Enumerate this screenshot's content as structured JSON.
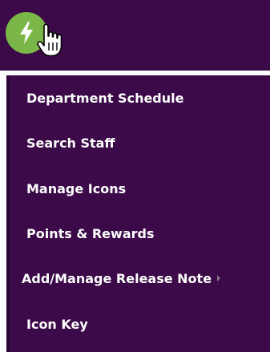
{
  "topbar": {
    "icon": "lightning-bolt-icon",
    "accent_color": "#7ab648",
    "background_color": "#3c0a49"
  },
  "menu": {
    "items": [
      {
        "label": "Department Schedule"
      },
      {
        "label": "Search Staff"
      },
      {
        "label": "Manage Icons"
      },
      {
        "label": "Points & Rewards"
      },
      {
        "label": "Add/Manage Release Note",
        "has_submenu": true
      },
      {
        "label": "Icon Key"
      }
    ]
  }
}
